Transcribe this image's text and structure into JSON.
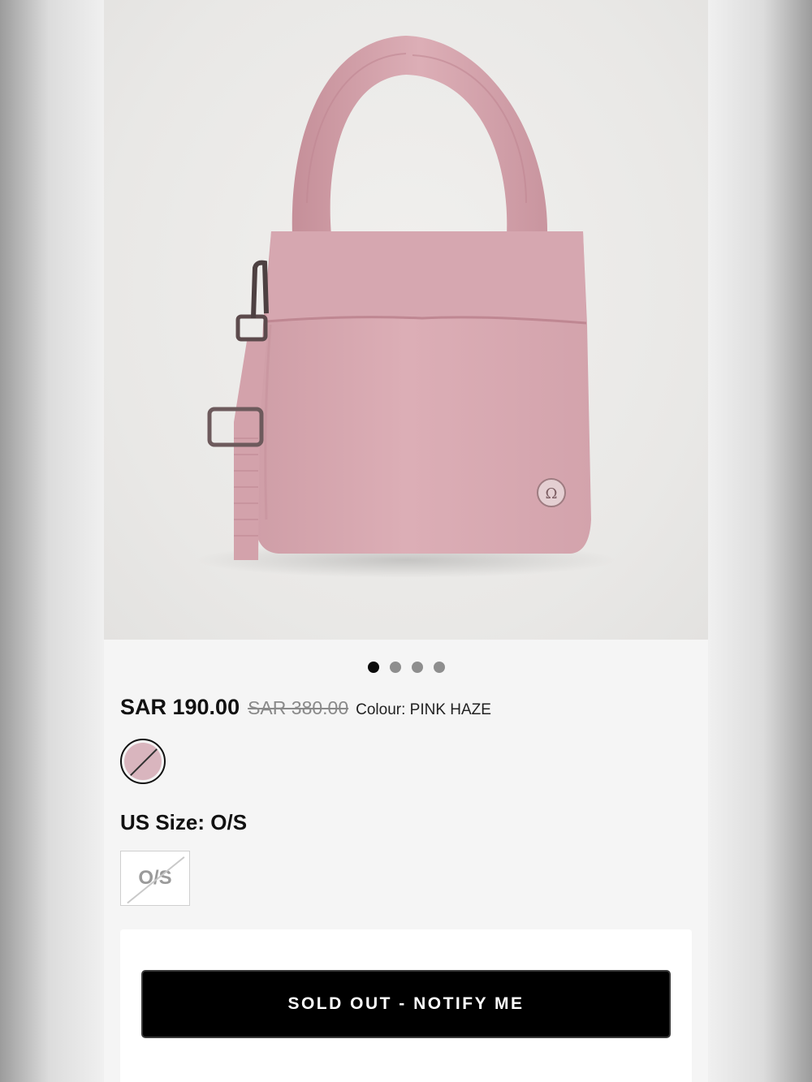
{
  "product": {
    "image_alt": "Pink tote bag with crossbody strap",
    "carousel_total": 4,
    "carousel_active": 1,
    "price": "SAR 190.00",
    "original_price": "SAR 380.00",
    "colour_label": "Colour: PINK HAZE",
    "swatch_color": "#d9b5be",
    "swatch_available": false,
    "size_heading": "US Size: O/S",
    "size_option": "O/S",
    "size_available": false
  },
  "cta": {
    "label": "SOLD OUT - NOTIFY ME"
  },
  "colors": {
    "bag_pink": "#d8a9b1",
    "button_bg": "#000000"
  }
}
